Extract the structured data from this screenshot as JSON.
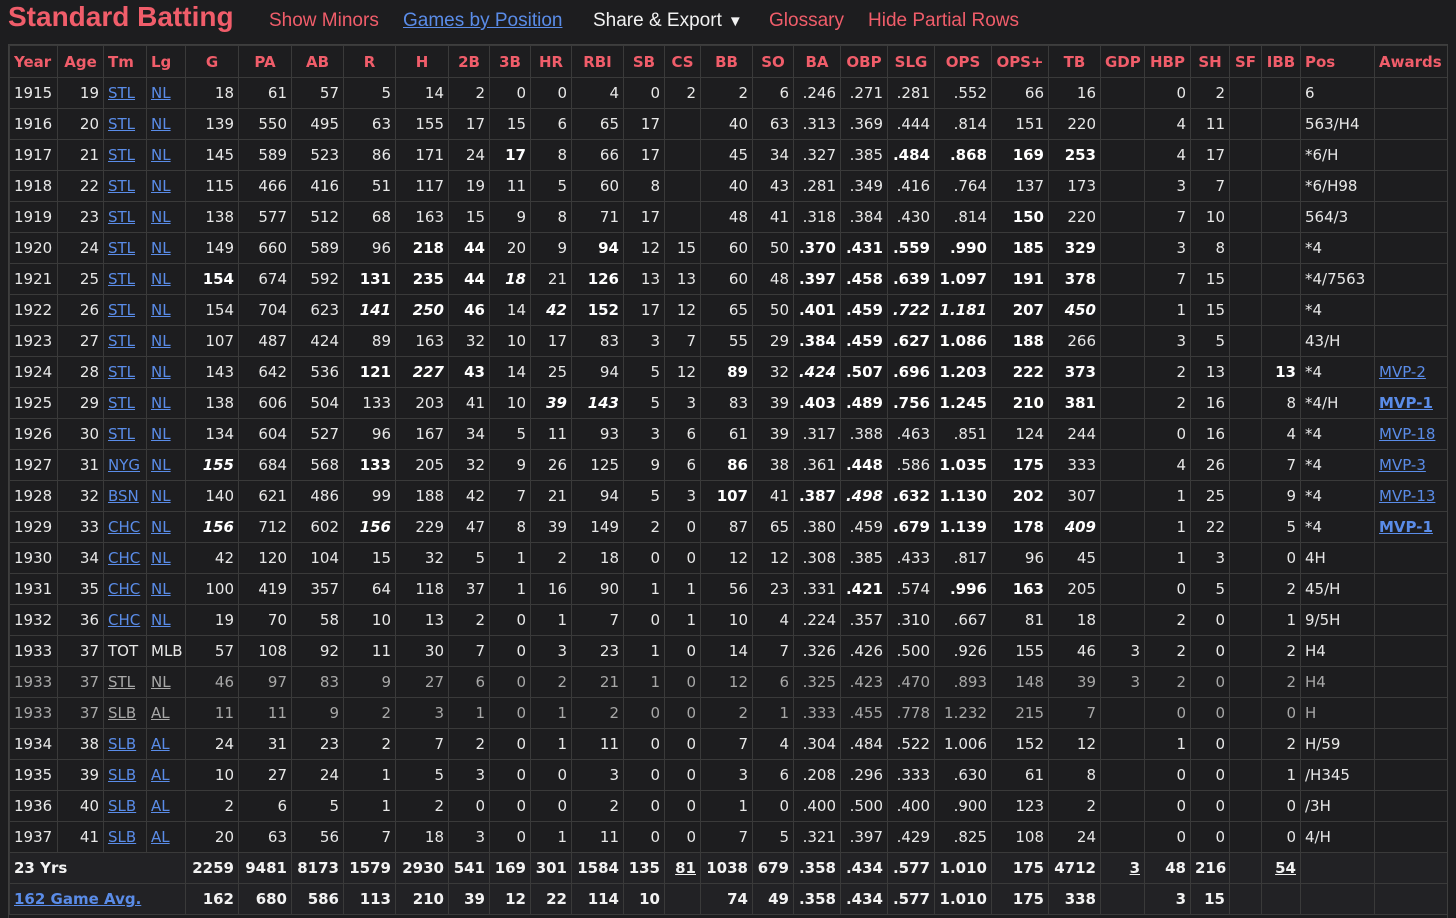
{
  "header": {
    "title": "Standard Batting",
    "show_minors": "Show Minors",
    "games_by_position": "Games by Position",
    "share_export": "Share & Export",
    "share_caret": "▼",
    "glossary": "Glossary",
    "hide_partial": "Hide Partial Rows"
  },
  "columns": [
    "Year",
    "Age",
    "Tm",
    "Lg",
    "G",
    "PA",
    "AB",
    "R",
    "H",
    "2B",
    "3B",
    "HR",
    "RBI",
    "SB",
    "CS",
    "BB",
    "SO",
    "BA",
    "OBP",
    "SLG",
    "OPS",
    "OPS+",
    "TB",
    "GDP",
    "HBP",
    "SH",
    "SF",
    "IBB",
    "Pos",
    "Awards"
  ],
  "rows": [
    {
      "partial": false,
      "cells": [
        "1915",
        "19",
        "STL",
        "NL",
        "18",
        "61",
        "57",
        "5",
        "14",
        "2",
        "0",
        "0",
        "4",
        "0",
        "2",
        "2",
        "6",
        ".246",
        ".271",
        ".281",
        ".552",
        "66",
        "16",
        "",
        "0",
        "2",
        "",
        "",
        "6",
        ""
      ],
      "bold": [],
      "bi": []
    },
    {
      "partial": false,
      "cells": [
        "1916",
        "20",
        "STL",
        "NL",
        "139",
        "550",
        "495",
        "63",
        "155",
        "17",
        "15",
        "6",
        "65",
        "17",
        "",
        "40",
        "63",
        ".313",
        ".369",
        ".444",
        ".814",
        "151",
        "220",
        "",
        "4",
        "11",
        "",
        "",
        "563/H4",
        ""
      ],
      "bold": [],
      "bi": []
    },
    {
      "partial": false,
      "cells": [
        "1917",
        "21",
        "STL",
        "NL",
        "145",
        "589",
        "523",
        "86",
        "171",
        "24",
        "17",
        "8",
        "66",
        "17",
        "",
        "45",
        "34",
        ".327",
        ".385",
        ".484",
        ".868",
        "169",
        "253",
        "",
        "4",
        "17",
        "",
        "",
        "*6/H",
        ""
      ],
      "bold": [
        10,
        19,
        20,
        21,
        22
      ],
      "bi": []
    },
    {
      "partial": false,
      "cells": [
        "1918",
        "22",
        "STL",
        "NL",
        "115",
        "466",
        "416",
        "51",
        "117",
        "19",
        "11",
        "5",
        "60",
        "8",
        "",
        "40",
        "43",
        ".281",
        ".349",
        ".416",
        ".764",
        "137",
        "173",
        "",
        "3",
        "7",
        "",
        "",
        "*6/H98",
        ""
      ],
      "bold": [],
      "bi": []
    },
    {
      "partial": false,
      "cells": [
        "1919",
        "23",
        "STL",
        "NL",
        "138",
        "577",
        "512",
        "68",
        "163",
        "15",
        "9",
        "8",
        "71",
        "17",
        "",
        "48",
        "41",
        ".318",
        ".384",
        ".430",
        ".814",
        "150",
        "220",
        "",
        "7",
        "10",
        "",
        "",
        "564/3",
        ""
      ],
      "bold": [
        21
      ],
      "bi": []
    },
    {
      "partial": false,
      "cells": [
        "1920",
        "24",
        "STL",
        "NL",
        "149",
        "660",
        "589",
        "96",
        "218",
        "44",
        "20",
        "9",
        "94",
        "12",
        "15",
        "60",
        "50",
        ".370",
        ".431",
        ".559",
        ".990",
        "185",
        "329",
        "",
        "3",
        "8",
        "",
        "",
        "*4",
        ""
      ],
      "bold": [
        8,
        9,
        12,
        17,
        18,
        19,
        20,
        21,
        22
      ],
      "bi": []
    },
    {
      "partial": false,
      "cells": [
        "1921",
        "25",
        "STL",
        "NL",
        "154",
        "674",
        "592",
        "131",
        "235",
        "44",
        "18",
        "21",
        "126",
        "13",
        "13",
        "60",
        "48",
        ".397",
        ".458",
        ".639",
        "1.097",
        "191",
        "378",
        "",
        "7",
        "15",
        "",
        "",
        "*4/7563",
        ""
      ],
      "bold": [
        4,
        7,
        8,
        9,
        12,
        17,
        18,
        19,
        20,
        21,
        22
      ],
      "bi": [
        10
      ]
    },
    {
      "partial": false,
      "cells": [
        "1922",
        "26",
        "STL",
        "NL",
        "154",
        "704",
        "623",
        "141",
        "250",
        "46",
        "14",
        "42",
        "152",
        "17",
        "12",
        "65",
        "50",
        ".401",
        ".459",
        ".722",
        "1.181",
        "207",
        "450",
        "",
        "1",
        "15",
        "",
        "",
        "*4",
        ""
      ],
      "bold": [
        9,
        12,
        17,
        18,
        21
      ],
      "bi": [
        7,
        8,
        11,
        19,
        20,
        22
      ]
    },
    {
      "partial": false,
      "cells": [
        "1923",
        "27",
        "STL",
        "NL",
        "107",
        "487",
        "424",
        "89",
        "163",
        "32",
        "10",
        "17",
        "83",
        "3",
        "7",
        "55",
        "29",
        ".384",
        ".459",
        ".627",
        "1.086",
        "188",
        "266",
        "",
        "3",
        "5",
        "",
        "",
        "43/H",
        ""
      ],
      "bold": [
        17,
        18,
        19,
        20,
        21
      ],
      "bi": []
    },
    {
      "partial": false,
      "cells": [
        "1924",
        "28",
        "STL",
        "NL",
        "143",
        "642",
        "536",
        "121",
        "227",
        "43",
        "14",
        "25",
        "94",
        "5",
        "12",
        "89",
        "32",
        ".424",
        ".507",
        ".696",
        "1.203",
        "222",
        "373",
        "",
        "2",
        "13",
        "",
        "13",
        "*4",
        "MVP-2"
      ],
      "bold": [
        7,
        9,
        15,
        18,
        19,
        20,
        21,
        22,
        27
      ],
      "bi": [
        8,
        17
      ]
    },
    {
      "partial": false,
      "cells": [
        "1925",
        "29",
        "STL",
        "NL",
        "138",
        "606",
        "504",
        "133",
        "203",
        "41",
        "10",
        "39",
        "143",
        "5",
        "3",
        "83",
        "39",
        ".403",
        ".489",
        ".756",
        "1.245",
        "210",
        "381",
        "",
        "2",
        "16",
        "",
        "8",
        "*4/H",
        "MVP-1"
      ],
      "bold": [
        17,
        18,
        19,
        20,
        21,
        22
      ],
      "bi": [
        11,
        12
      ]
    },
    {
      "partial": false,
      "cells": [
        "1926",
        "30",
        "STL",
        "NL",
        "134",
        "604",
        "527",
        "96",
        "167",
        "34",
        "5",
        "11",
        "93",
        "3",
        "6",
        "61",
        "39",
        ".317",
        ".388",
        ".463",
        ".851",
        "124",
        "244",
        "",
        "0",
        "16",
        "",
        "4",
        "*4",
        "MVP-18"
      ],
      "bold": [],
      "bi": []
    },
    {
      "partial": false,
      "cells": [
        "1927",
        "31",
        "NYG",
        "NL",
        "155",
        "684",
        "568",
        "133",
        "205",
        "32",
        "9",
        "26",
        "125",
        "9",
        "6",
        "86",
        "38",
        ".361",
        ".448",
        ".586",
        "1.035",
        "175",
        "333",
        "",
        "4",
        "26",
        "",
        "7",
        "*4",
        "MVP-3"
      ],
      "bold": [
        7,
        15,
        18,
        20,
        21
      ],
      "bi": [
        4
      ]
    },
    {
      "partial": false,
      "cells": [
        "1928",
        "32",
        "BSN",
        "NL",
        "140",
        "621",
        "486",
        "99",
        "188",
        "42",
        "7",
        "21",
        "94",
        "5",
        "3",
        "107",
        "41",
        ".387",
        ".498",
        ".632",
        "1.130",
        "202",
        "307",
        "",
        "1",
        "25",
        "",
        "9",
        "*4",
        "MVP-13"
      ],
      "bold": [
        15,
        17,
        19,
        20,
        21
      ],
      "bi": [
        18
      ]
    },
    {
      "partial": false,
      "cells": [
        "1929",
        "33",
        "CHC",
        "NL",
        "156",
        "712",
        "602",
        "156",
        "229",
        "47",
        "8",
        "39",
        "149",
        "2",
        "0",
        "87",
        "65",
        ".380",
        ".459",
        ".679",
        "1.139",
        "178",
        "409",
        "",
        "1",
        "22",
        "",
        "5",
        "*4",
        "MVP-1"
      ],
      "bold": [
        19,
        20,
        21
      ],
      "bi": [
        4,
        7,
        22
      ]
    },
    {
      "partial": false,
      "cells": [
        "1930",
        "34",
        "CHC",
        "NL",
        "42",
        "120",
        "104",
        "15",
        "32",
        "5",
        "1",
        "2",
        "18",
        "0",
        "0",
        "12",
        "12",
        ".308",
        ".385",
        ".433",
        ".817",
        "96",
        "45",
        "",
        "1",
        "3",
        "",
        "0",
        "4H",
        ""
      ],
      "bold": [],
      "bi": []
    },
    {
      "partial": false,
      "cells": [
        "1931",
        "35",
        "CHC",
        "NL",
        "100",
        "419",
        "357",
        "64",
        "118",
        "37",
        "1",
        "16",
        "90",
        "1",
        "1",
        "56",
        "23",
        ".331",
        ".421",
        ".574",
        ".996",
        "163",
        "205",
        "",
        "0",
        "5",
        "",
        "2",
        "45/H",
        ""
      ],
      "bold": [
        18,
        20,
        21
      ],
      "bi": []
    },
    {
      "partial": false,
      "cells": [
        "1932",
        "36",
        "CHC",
        "NL",
        "19",
        "70",
        "58",
        "10",
        "13",
        "2",
        "0",
        "1",
        "7",
        "0",
        "1",
        "10",
        "4",
        ".224",
        ".357",
        ".310",
        ".667",
        "81",
        "18",
        "",
        "2",
        "0",
        "",
        "1",
        "9/5H",
        ""
      ],
      "bold": [],
      "bi": []
    },
    {
      "partial": false,
      "cells": [
        "1933",
        "37",
        "TOT",
        "MLB",
        "57",
        "108",
        "92",
        "11",
        "30",
        "7",
        "0",
        "3",
        "23",
        "1",
        "0",
        "14",
        "7",
        ".326",
        ".426",
        ".500",
        ".926",
        "155",
        "46",
        "3",
        "2",
        "0",
        "",
        "2",
        "H4",
        ""
      ],
      "bold": [],
      "bi": []
    },
    {
      "partial": true,
      "cells": [
        "1933",
        "37",
        "STL",
        "NL",
        "46",
        "97",
        "83",
        "9",
        "27",
        "6",
        "0",
        "2",
        "21",
        "1",
        "0",
        "12",
        "6",
        ".325",
        ".423",
        ".470",
        ".893",
        "148",
        "39",
        "3",
        "2",
        "0",
        "",
        "2",
        "H4",
        ""
      ],
      "bold": [],
      "bi": []
    },
    {
      "partial": true,
      "cells": [
        "1933",
        "37",
        "SLB",
        "AL",
        "11",
        "11",
        "9",
        "2",
        "3",
        "1",
        "0",
        "1",
        "2",
        "0",
        "0",
        "2",
        "1",
        ".333",
        ".455",
        ".778",
        "1.232",
        "215",
        "7",
        "",
        "0",
        "0",
        "",
        "0",
        "H",
        ""
      ],
      "bold": [],
      "bi": []
    },
    {
      "partial": false,
      "cells": [
        "1934",
        "38",
        "SLB",
        "AL",
        "24",
        "31",
        "23",
        "2",
        "7",
        "2",
        "0",
        "1",
        "11",
        "0",
        "0",
        "7",
        "4",
        ".304",
        ".484",
        ".522",
        "1.006",
        "152",
        "12",
        "",
        "1",
        "0",
        "",
        "2",
        "H/59",
        ""
      ],
      "bold": [],
      "bi": []
    },
    {
      "partial": false,
      "cells": [
        "1935",
        "39",
        "SLB",
        "AL",
        "10",
        "27",
        "24",
        "1",
        "5",
        "3",
        "0",
        "0",
        "3",
        "0",
        "0",
        "3",
        "6",
        ".208",
        ".296",
        ".333",
        ".630",
        "61",
        "8",
        "",
        "0",
        "0",
        "",
        "1",
        "/H345",
        ""
      ],
      "bold": [],
      "bi": []
    },
    {
      "partial": false,
      "cells": [
        "1936",
        "40",
        "SLB",
        "AL",
        "2",
        "6",
        "5",
        "1",
        "2",
        "0",
        "0",
        "0",
        "2",
        "0",
        "0",
        "1",
        "0",
        ".400",
        ".500",
        ".400",
        ".900",
        "123",
        "2",
        "",
        "0",
        "0",
        "",
        "0",
        "/3H",
        ""
      ],
      "bold": [],
      "bi": []
    },
    {
      "partial": false,
      "cells": [
        "1937",
        "41",
        "SLB",
        "AL",
        "20",
        "63",
        "56",
        "7",
        "18",
        "3",
        "0",
        "1",
        "11",
        "0",
        "0",
        "7",
        "5",
        ".321",
        ".397",
        ".429",
        ".825",
        "108",
        "24",
        "",
        "0",
        "0",
        "",
        "0",
        "4/H",
        ""
      ],
      "bold": [],
      "bi": []
    }
  ],
  "footer": [
    {
      "label": "23 Yrs",
      "link": false,
      "cells": [
        "2259",
        "9481",
        "8173",
        "1579",
        "2930",
        "541",
        "169",
        "301",
        "1584",
        "135",
        "81",
        "1038",
        "679",
        ".358",
        ".434",
        ".577",
        "1.010",
        "175",
        "4712",
        "3",
        "48",
        "216",
        "",
        "54",
        "",
        ""
      ],
      "underline": [
        10,
        19,
        23
      ]
    },
    {
      "label": "162 Game Avg.",
      "link": true,
      "cells": [
        "162",
        "680",
        "586",
        "113",
        "210",
        "39",
        "12",
        "22",
        "114",
        "10",
        "",
        "74",
        "49",
        ".358",
        ".434",
        ".577",
        "1.010",
        "175",
        "338",
        "",
        "3",
        "15",
        "",
        "",
        "",
        ""
      ],
      "underline": []
    }
  ],
  "colors": {
    "accent": "#f05d6a",
    "link": "#5a8ce8",
    "background": "#1d1d1f"
  }
}
